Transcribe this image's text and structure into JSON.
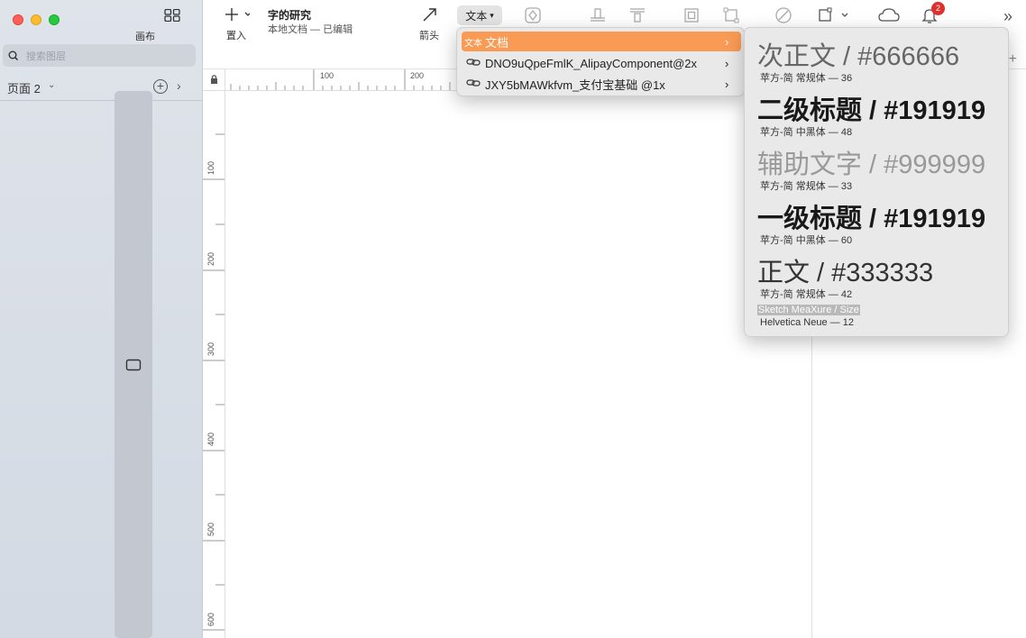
{
  "sidebar": {
    "canvas_label": "画布",
    "search_placeholder": "搜索图层",
    "page_label": "页面 2"
  },
  "toolbar": {
    "insert_label": "置入",
    "doc_title": "字的研究",
    "doc_subtitle": "本地文档 — 已编辑",
    "arrow_label": "箭头",
    "text_button": "文本",
    "notification_count": "2"
  },
  "rulers": {
    "top": [
      "100",
      "200"
    ],
    "left": [
      "100",
      "200",
      "300",
      "400",
      "500",
      "600"
    ]
  },
  "menu": {
    "items": [
      {
        "icon": "文本",
        "label": "文档",
        "active": true
      },
      {
        "icon": "link-icon",
        "label": "DNO9uQpeFmlK_AlipayComponent@2x",
        "active": false
      },
      {
        "icon": "link-icon",
        "label": "JXY5bMAWkfvm_支付宝基础 @1x",
        "active": false
      }
    ]
  },
  "submenu": {
    "styles": [
      {
        "title": "次正文 / #666666",
        "meta": "苹方-简 常规体 — 36",
        "color": "#666666"
      },
      {
        "title": "二级标题 / #191919",
        "meta": "苹方-简 中黑体 — 48",
        "color": "#191919"
      },
      {
        "title": "辅助文字 / #999999",
        "meta": "苹方-简 常规体 — 33",
        "color": "#999999"
      },
      {
        "title": "一级标题 / #191919",
        "meta": "苹方-简 中黑体 — 60",
        "color": "#191919"
      },
      {
        "title": "正文 / #333333",
        "meta": "苹方-简 常规体 — 42",
        "color": "#333333"
      }
    ],
    "highlighted": {
      "title": "Sketch MeaXure / Size",
      "meta": "Helvetica Neue — 12"
    }
  },
  "accent": "#fa9b55"
}
